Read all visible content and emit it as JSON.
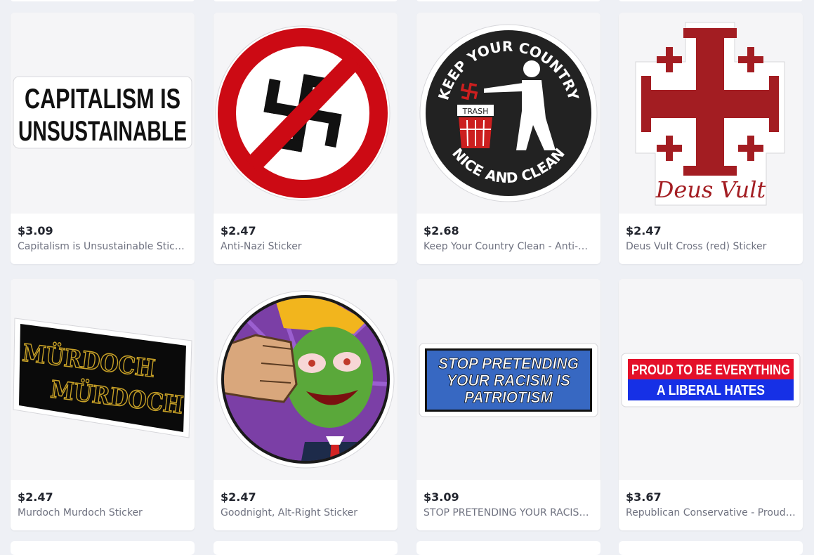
{
  "products": [
    {
      "price": "$3.09",
      "title": "Capitalism is Unsustainable Sticker",
      "sticker_text": [
        "CAPITALISM IS",
        "UNSUSTAINABLE"
      ]
    },
    {
      "price": "$2.47",
      "title": "Anti-Nazi Sticker"
    },
    {
      "price": "$2.68",
      "title": "Keep Your Country Clean - Anti-Nazi Sticker",
      "sticker_text": [
        "KEEP YOUR COUNTRY",
        "NICE AND CLEAN",
        "TRASH"
      ]
    },
    {
      "price": "$2.47",
      "title": "Deus Vult Cross (red) Sticker",
      "sticker_text": [
        "Deus Vult"
      ]
    },
    {
      "price": "$2.47",
      "title": "Murdoch Murdoch Sticker",
      "sticker_text": [
        "MÜRDOCH",
        "MÜRDOCH"
      ]
    },
    {
      "price": "$2.47",
      "title": "Goodnight, Alt-Right Sticker"
    },
    {
      "price": "$3.09",
      "title": "STOP PRETENDING YOUR RACISM IS PATRIOTISM Sticker",
      "sticker_text": [
        "STOP PRETENDING",
        "YOUR RACISM IS",
        "PATRIOTISM"
      ]
    },
    {
      "price": "$3.67",
      "title": "Republican Conservative - Proud To Be Everything A Liberal Hates Sticker",
      "sticker_text": [
        "PROUD TO BE EVERYTHING",
        "A LIBERAL HATES"
      ]
    }
  ],
  "colors": {
    "page_bg": "#eef0f5",
    "card_bg": "#ffffff",
    "image_bg": "#f5f5f7",
    "price": "#22252e",
    "title": "#6f7280"
  }
}
